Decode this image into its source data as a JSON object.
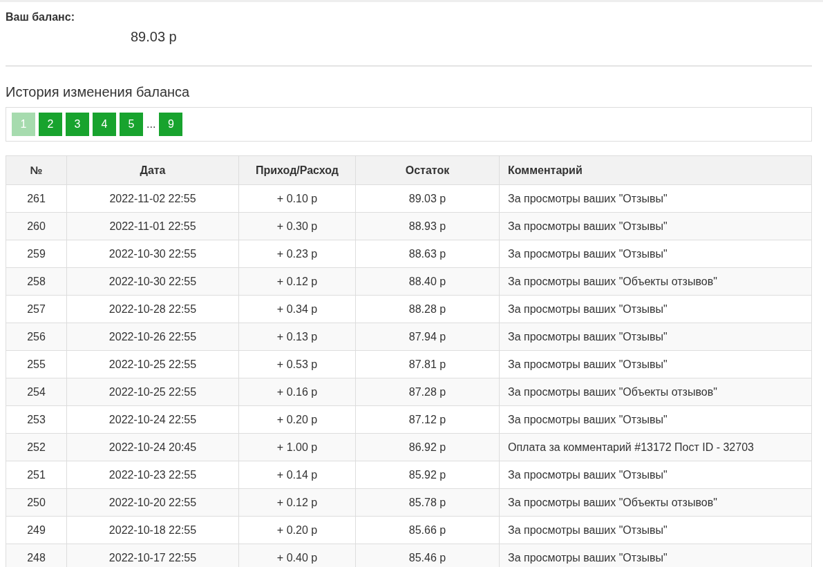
{
  "balance": {
    "label": "Ваш баланс:",
    "value": "89.03 р"
  },
  "history": {
    "title": "История изменения баланса"
  },
  "pagination": [
    {
      "kind": "page",
      "label": "1",
      "selected": true
    },
    {
      "kind": "page",
      "label": "2",
      "selected": false
    },
    {
      "kind": "page",
      "label": "3",
      "selected": false
    },
    {
      "kind": "page",
      "label": "4",
      "selected": false
    },
    {
      "kind": "page",
      "label": "5",
      "selected": false
    },
    {
      "kind": "ellipsis",
      "label": "..."
    },
    {
      "kind": "page",
      "label": "9",
      "selected": false
    }
  ],
  "table": {
    "columns": [
      "№",
      "Дата",
      "Приход/Расход",
      "Остаток",
      "Комментарий"
    ],
    "rows": [
      [
        "261",
        "2022-11-02 22:55",
        "+ 0.10 р",
        "89.03 р",
        "За просмотры ваших \"Отзывы\""
      ],
      [
        "260",
        "2022-11-01 22:55",
        "+ 0.30 р",
        "88.93 р",
        "За просмотры ваших \"Отзывы\""
      ],
      [
        "259",
        "2022-10-30 22:55",
        "+ 0.23 р",
        "88.63 р",
        "За просмотры ваших \"Отзывы\""
      ],
      [
        "258",
        "2022-10-30 22:55",
        "+ 0.12 р",
        "88.40 р",
        "За просмотры ваших \"Объекты отзывов\""
      ],
      [
        "257",
        "2022-10-28 22:55",
        "+ 0.34 р",
        "88.28 р",
        "За просмотры ваших \"Отзывы\""
      ],
      [
        "256",
        "2022-10-26 22:55",
        "+ 0.13 р",
        "87.94 р",
        "За просмотры ваших \"Отзывы\""
      ],
      [
        "255",
        "2022-10-25 22:55",
        "+ 0.53 р",
        "87.81 р",
        "За просмотры ваших \"Отзывы\""
      ],
      [
        "254",
        "2022-10-25 22:55",
        "+ 0.16 р",
        "87.28 р",
        "За просмотры ваших \"Объекты отзывов\""
      ],
      [
        "253",
        "2022-10-24 22:55",
        "+ 0.20 р",
        "87.12 р",
        "За просмотры ваших \"Отзывы\""
      ],
      [
        "252",
        "2022-10-24 20:45",
        "+ 1.00 р",
        "86.92 р",
        "Оплата за комментарий #13172 Пост ID - 32703"
      ],
      [
        "251",
        "2022-10-23 22:55",
        "+ 0.14 р",
        "85.92 р",
        "За просмотры ваших \"Отзывы\""
      ],
      [
        "250",
        "2022-10-20 22:55",
        "+ 0.12 р",
        "85.78 р",
        "За просмотры ваших \"Объекты отзывов\""
      ],
      [
        "249",
        "2022-10-18 22:55",
        "+ 0.20 р",
        "85.66 р",
        "За просмотры ваших \"Отзывы\""
      ],
      [
        "248",
        "2022-10-17 22:55",
        "+ 0.40 р",
        "85.46 р",
        "За просмотры ваших \"Отзывы\""
      ]
    ]
  }
}
